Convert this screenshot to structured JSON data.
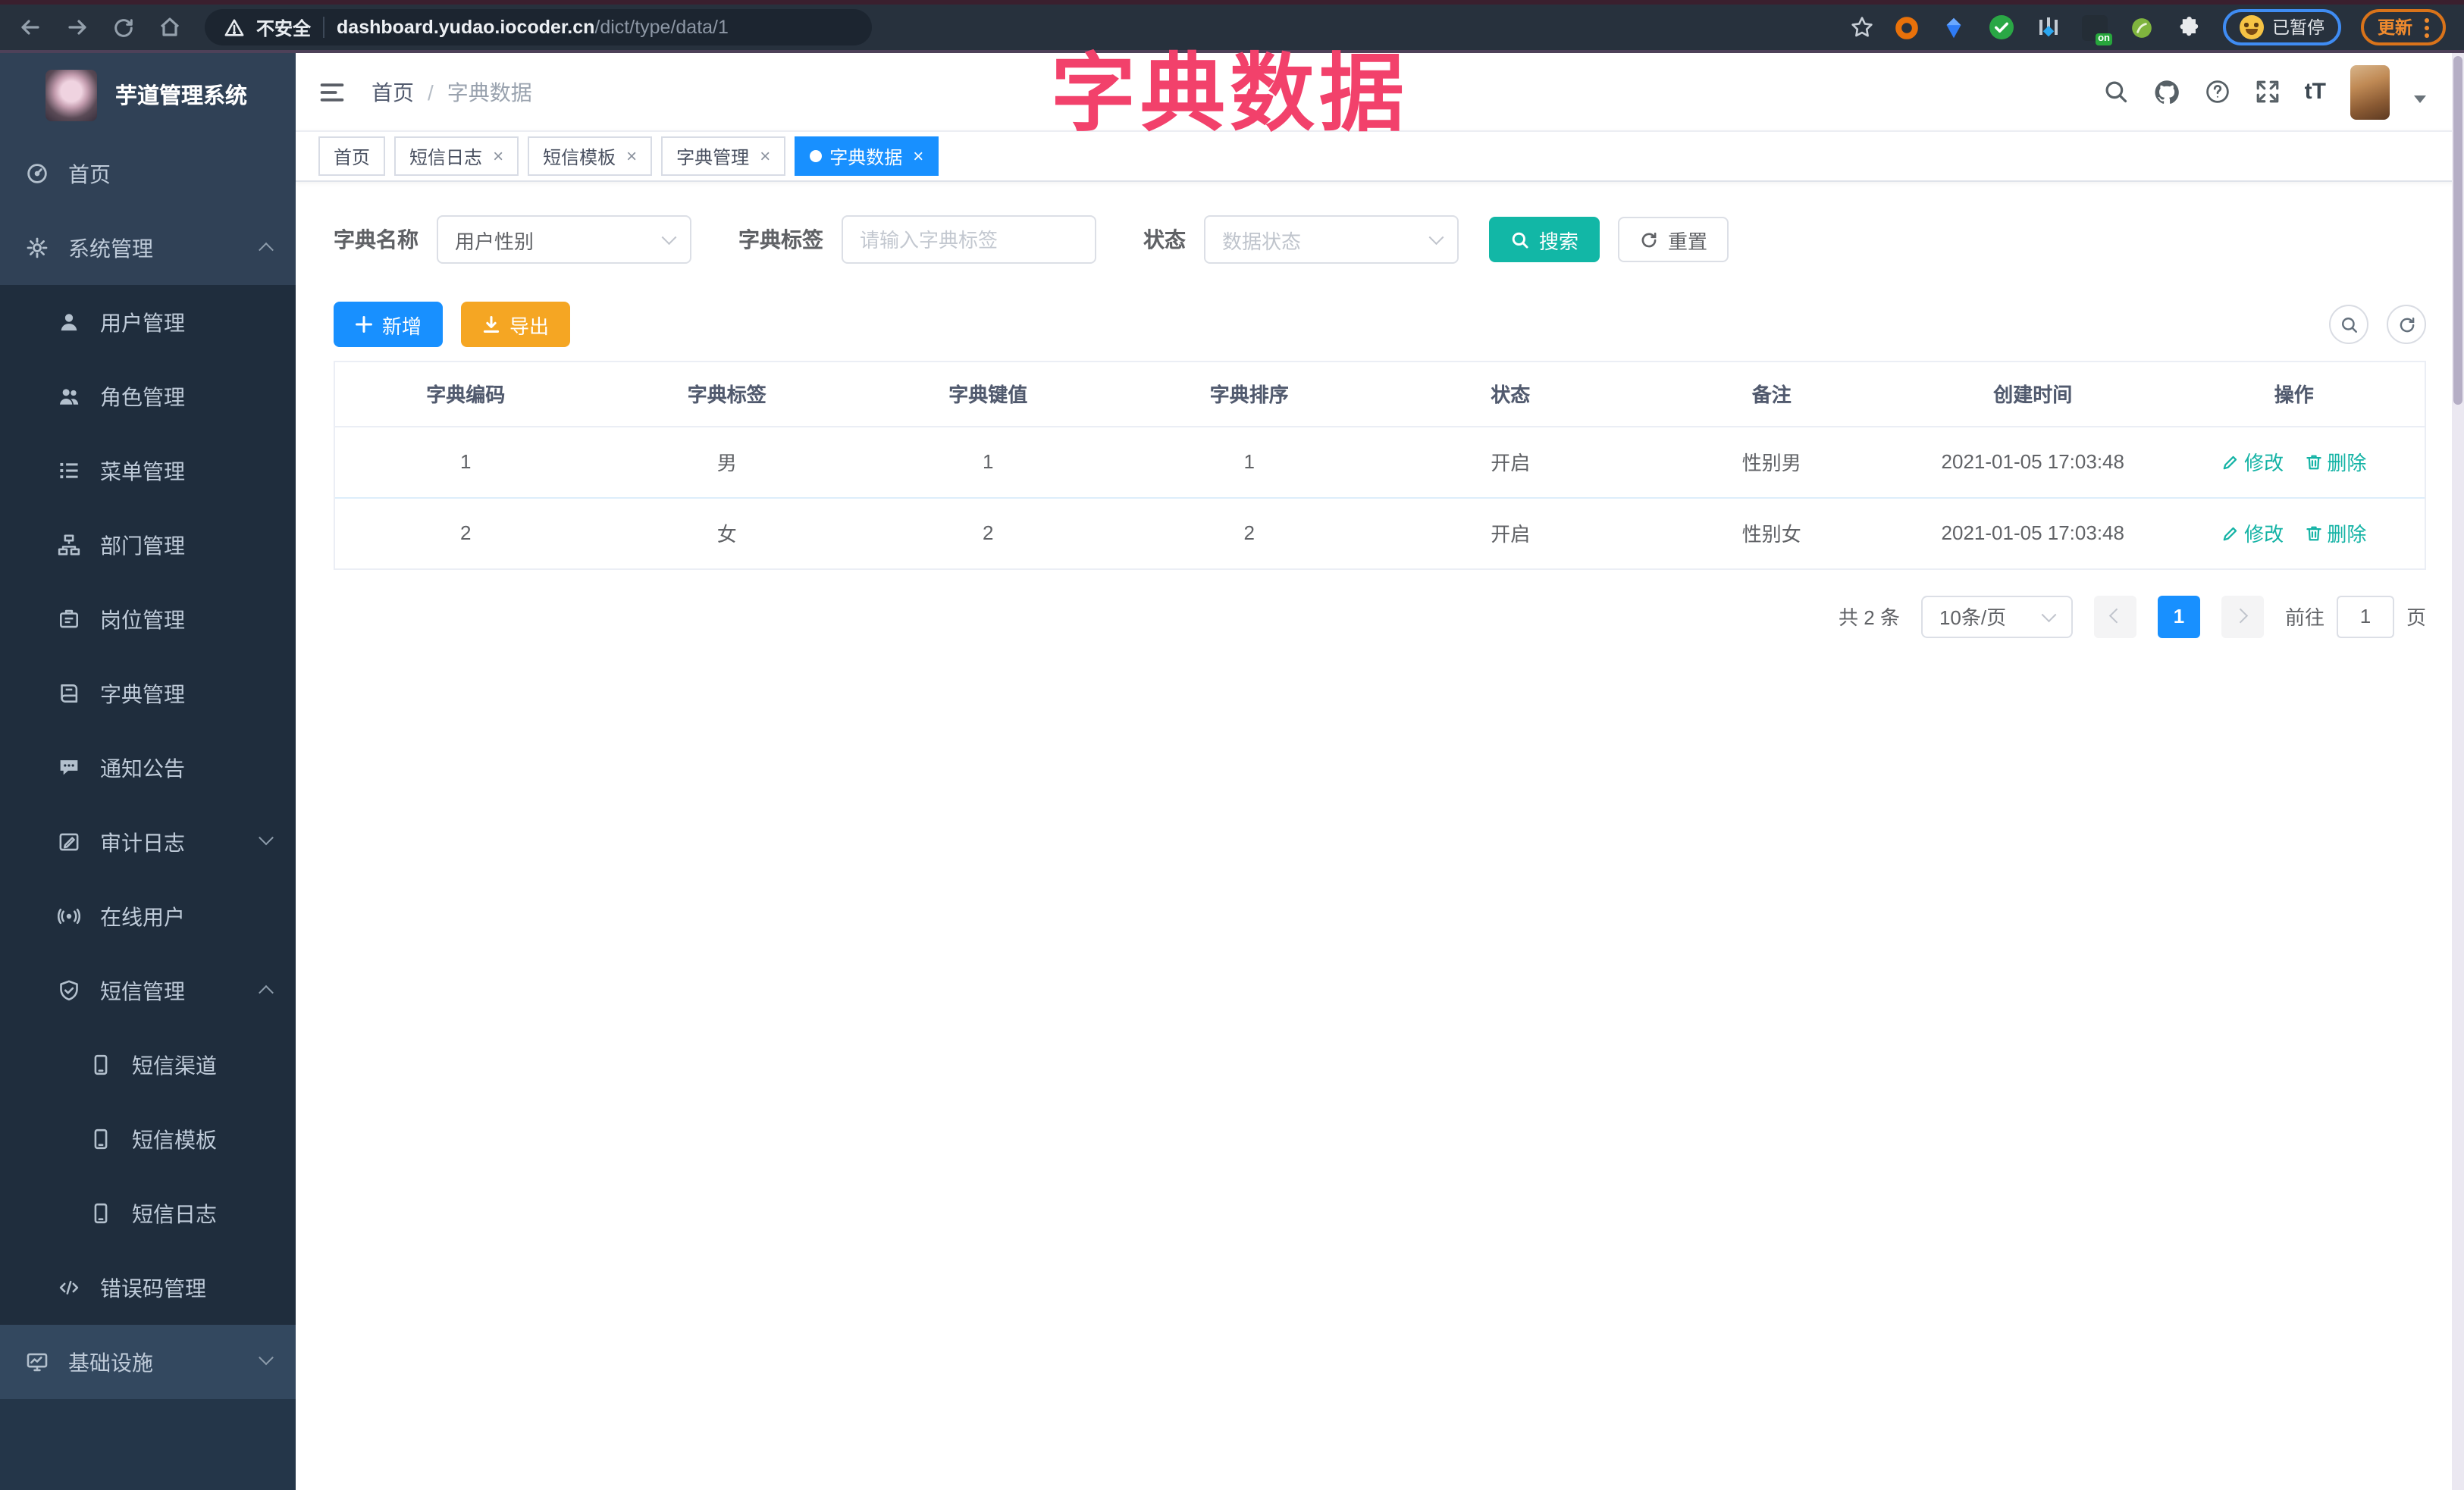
{
  "browser": {
    "security_label": "不安全",
    "url_domain": "dashboard.yudao.iocoder.cn",
    "url_path": "/dict/type/data/1",
    "profile_badge": "已暂停",
    "update_label": "更新"
  },
  "overlay_title": "字典数据",
  "sidebar": {
    "logo_title": "芋道管理系统",
    "items": [
      {
        "label": "首页",
        "icon": "dashboard-icon",
        "level": 1
      },
      {
        "label": "系统管理",
        "icon": "gear-icon",
        "level": 1,
        "state": "expanded"
      },
      {
        "label": "用户管理",
        "icon": "user-icon",
        "level": 2
      },
      {
        "label": "角色管理",
        "icon": "users-icon",
        "level": 2
      },
      {
        "label": "菜单管理",
        "icon": "menu-list-icon",
        "level": 2
      },
      {
        "label": "部门管理",
        "icon": "org-tree-icon",
        "level": 2
      },
      {
        "label": "岗位管理",
        "icon": "badge-icon",
        "level": 2
      },
      {
        "label": "字典管理",
        "icon": "dictionary-icon",
        "level": 2
      },
      {
        "label": "通知公告",
        "icon": "announcement-icon",
        "level": 2
      },
      {
        "label": "审计日志",
        "icon": "audit-log-icon",
        "level": 2,
        "state": "collapsed"
      },
      {
        "label": "在线用户",
        "icon": "online-user-icon",
        "level": 2
      },
      {
        "label": "短信管理",
        "icon": "shield-check-icon",
        "level": 2,
        "state": "expanded"
      },
      {
        "label": "短信渠道",
        "icon": "mobile-icon",
        "level": 3
      },
      {
        "label": "短信模板",
        "icon": "mobile-icon",
        "level": 3
      },
      {
        "label": "短信日志",
        "icon": "mobile-icon",
        "level": 3
      },
      {
        "label": "错误码管理",
        "icon": "code-icon",
        "level": 2
      },
      {
        "label": "基础设施",
        "icon": "monitor-icon",
        "level": 1,
        "state": "collapsed"
      }
    ]
  },
  "header": {
    "breadcrumb": {
      "home": "首页",
      "sep": "/",
      "current": "字典数据"
    }
  },
  "tags": [
    {
      "label": "首页"
    },
    {
      "label": "短信日志"
    },
    {
      "label": "短信模板"
    },
    {
      "label": "字典管理"
    },
    {
      "label": "字典数据",
      "active": true
    }
  ],
  "filters": {
    "dict_name_label": "字典名称",
    "dict_name_value": "用户性别",
    "dict_label_label": "字典标签",
    "dict_label_placeholder": "请输入字典标签",
    "status_label": "状态",
    "status_placeholder": "数据状态",
    "search_label": "搜索",
    "reset_label": "重置"
  },
  "toolbar": {
    "add_label": "新增",
    "export_label": "导出"
  },
  "table": {
    "headers": [
      "字典编码",
      "字典标签",
      "字典键值",
      "字典排序",
      "状态",
      "备注",
      "创建时间",
      "操作"
    ],
    "rows": [
      {
        "code": "1",
        "label": "男",
        "value": "1",
        "sort": "1",
        "status": "开启",
        "remark": "性别男",
        "created": "2021-01-05 17:03:48"
      },
      {
        "code": "2",
        "label": "女",
        "value": "2",
        "sort": "2",
        "status": "开启",
        "remark": "性别女",
        "created": "2021-01-05 17:03:48"
      }
    ],
    "actions": {
      "modify": "修改",
      "delete": "删除"
    }
  },
  "pagination": {
    "total_text": "共 2 条",
    "page_size": "10条/页",
    "current_page": "1",
    "goto_label": "前往",
    "goto_value": "1",
    "goto_suffix": "页"
  },
  "colors": {
    "primary": "#1890ff",
    "search_teal": "#12b7a6",
    "export_amber": "#f5a623",
    "overlay_pink": "#f2416b",
    "sidebar_bg": "#304156",
    "submenu_bg": "#1f2d3d"
  }
}
